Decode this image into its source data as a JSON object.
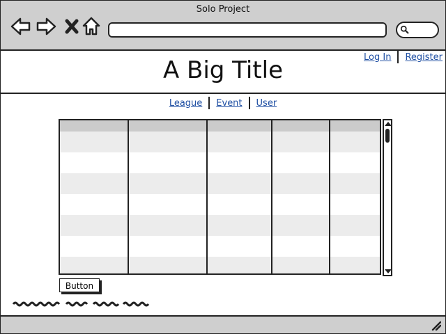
{
  "window": {
    "title": "Solo Project"
  },
  "header": {
    "title": "A Big Title",
    "login_label": "Log In",
    "register_label": "Register"
  },
  "nav": {
    "items": [
      {
        "label": "League"
      },
      {
        "label": "Event"
      },
      {
        "label": "User"
      }
    ]
  },
  "table": {
    "columns": 5,
    "rows": 7,
    "has_header": true,
    "has_vertical_scrollbar": true
  },
  "main": {
    "button_label": "Button"
  },
  "colors": {
    "chrome_bg": "#cfcfcf",
    "link": "#1f4fa3",
    "row_alt": "#ececec",
    "header_row": "#cbcbcb"
  },
  "icons": [
    "back-arrow-icon",
    "forward-arrow-icon",
    "close-x-icon",
    "home-icon",
    "search-icon",
    "resize-grip-icon"
  ]
}
